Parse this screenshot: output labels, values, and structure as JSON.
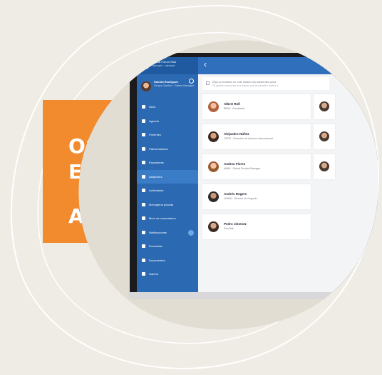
{
  "promo": {
    "lines": [
      "OS",
      "E",
      "ADA"
    ],
    "accent": "#f28a2e"
  },
  "app": {
    "org_name": "Virtual Forum SSA",
    "org_sub": "ejemplo · ejemplo",
    "user_name": "Sandra Rodriguez",
    "user_role": "Grupo Garrido · Sales Manager",
    "banner_text": "Elija su invitado en este listado los asistentes para",
    "banner_sub": "Si quiere escuchar sus ideas que le permite poder ir",
    "nav": [
      {
        "label": "Inicio",
        "icon": "home-icon"
      },
      {
        "label": "Agenda",
        "icon": "calendar-icon"
      },
      {
        "label": "Ponentes",
        "icon": "person-icon"
      },
      {
        "label": "Patrocinadores",
        "icon": "sponsor-icon"
      },
      {
        "label": "Expositores",
        "icon": "stand-icon"
      },
      {
        "label": "Asistentes",
        "icon": "people-icon"
      },
      {
        "label": "Actividades",
        "icon": "activity-icon"
      },
      {
        "label": "Mensajería privada",
        "icon": "message-icon"
      },
      {
        "label": "Muro de comentarios",
        "icon": "wall-icon"
      },
      {
        "label": "Notificaciones",
        "icon": "bell-icon"
      },
      {
        "label": "Encuestas",
        "icon": "poll-icon"
      },
      {
        "label": "Documentos",
        "icon": "document-icon"
      },
      {
        "label": "Galería",
        "icon": "gallery-icon"
      }
    ],
    "active_nav": 5,
    "attendees": [
      {
        "name": "Albert Roll",
        "role": "BBVA · Presidente"
      },
      {
        "name": "Alejandro Núñez",
        "role": "CEOE · Dirección de Asuntos Internacional"
      },
      {
        "name": "Andrea Flores",
        "role": "IAMM · Global Product Manager"
      },
      {
        "name": "Andrés Rogers",
        "role": "LINKIN · Director de Negocio"
      },
      {
        "name": "Pedro Jimenez",
        "role": "SoloTalk"
      }
    ]
  },
  "colors": {
    "sidebar": "#2b69b2",
    "topbar": "#2f6fbc",
    "background": "#efece5"
  }
}
